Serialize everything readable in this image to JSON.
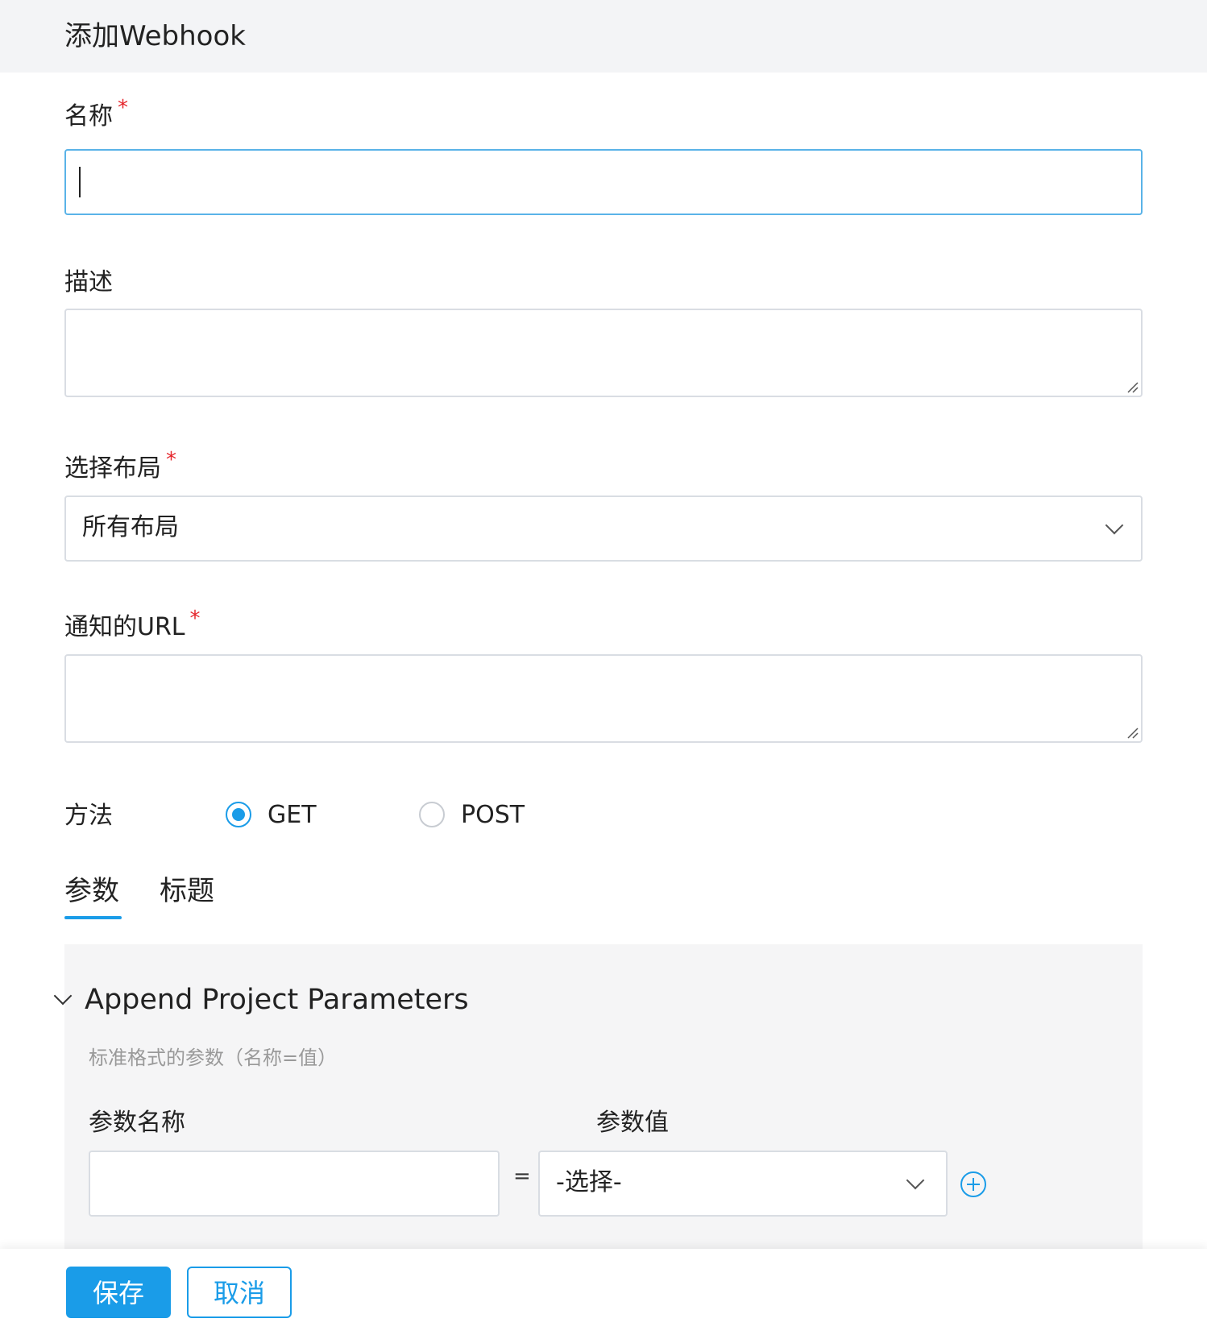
{
  "header": {
    "title": "添加Webhook"
  },
  "form": {
    "name": {
      "label": "名称",
      "required_mark": "*",
      "value": ""
    },
    "description": {
      "label": "描述",
      "value": ""
    },
    "layout": {
      "label": "选择布局",
      "required_mark": "*",
      "selected": "所有布局"
    },
    "url": {
      "label": "通知的URL",
      "required_mark": "*",
      "value": ""
    },
    "method": {
      "label": "方法",
      "options": [
        {
          "label": "GET",
          "checked": true
        },
        {
          "label": "POST",
          "checked": false
        }
      ]
    }
  },
  "tabs": [
    {
      "label": "参数",
      "active": true
    },
    {
      "label": "标题",
      "active": false
    }
  ],
  "params_panel": {
    "title": "Append Project Parameters",
    "hint": "标准格式的参数（名称=值）",
    "name_column_label": "参数名称",
    "value_column_label": "参数值",
    "equals": "=",
    "name_value": "",
    "value_select": "-选择-"
  },
  "footer": {
    "save_label": "保存",
    "cancel_label": "取消"
  },
  "colors": {
    "accent": "#1a9ce8",
    "required": "#e5262c",
    "header_bg": "#f3f4f6",
    "panel_bg": "#f5f5f6"
  },
  "icons": [
    "chevron-down-icon",
    "plus-circle-icon",
    "resize-grip-icon"
  ]
}
